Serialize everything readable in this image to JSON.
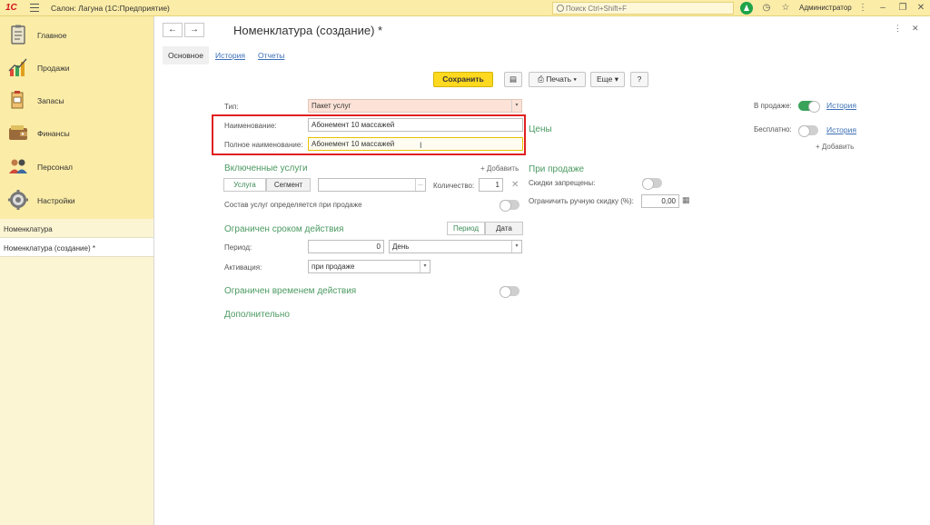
{
  "titlebar": {
    "app_title": "Салон: Лагуна  (1С:Предприятие)",
    "search_placeholder": "Поиск Ctrl+Shift+F",
    "user": "Администратор"
  },
  "sidebar": {
    "sections": [
      {
        "label": "Главное",
        "icon": "clipboard-icon"
      },
      {
        "label": "Продажи",
        "icon": "chart-icon"
      },
      {
        "label": "Запасы",
        "icon": "box-icon"
      },
      {
        "label": "Финансы",
        "icon": "wallet-icon"
      },
      {
        "label": "Персонал",
        "icon": "people-icon"
      },
      {
        "label": "Настройки",
        "icon": "gear-icon"
      }
    ],
    "open_windows": [
      {
        "label": "Номенклатура"
      },
      {
        "label": "Номенклатура (создание) *"
      }
    ]
  },
  "form": {
    "title": "Номенклатура (создание) *",
    "tabs": {
      "main": "Основное",
      "history": "История",
      "reports": "Отчеты"
    },
    "toolbar": {
      "save": "Сохранить",
      "print": "Печать",
      "more": "Еще",
      "help": "?"
    },
    "fields": {
      "type_label": "Тип:",
      "type_value": "Пакет услуг",
      "name_label": "Наименование:",
      "name_value": "Абонемент 10 массажей",
      "fullname_label": "Полное наименование:",
      "fullname_value": "Абонемент 10 массажей"
    },
    "included": {
      "header": "Включенные услуги",
      "add": "+ Добавить",
      "seg_service": "Услуга",
      "seg_segment": "Сегмент",
      "quantity_label": "Количество:",
      "quantity_value": "1",
      "composition_label": "Состав услуг определяется при продаже"
    },
    "term": {
      "header": "Ограничен сроком действия",
      "seg_period": "Период",
      "seg_date": "Дата",
      "period_label": "Период:",
      "period_value": "0",
      "period_unit": "День",
      "activation_label": "Активация:",
      "activation_value": "при продаже"
    },
    "time_limit": {
      "header": "Ограничен временем действия"
    },
    "additional": {
      "header": "Дополнительно"
    },
    "prices": {
      "header": "Цены"
    },
    "sale": {
      "in_sale_label": "В продаже:",
      "history": "История",
      "free_label": "Бесплатно:",
      "free_history": "История",
      "add": "+ Добавить",
      "header": "При продаже",
      "discounts_label": "Скидки запрещены:",
      "manual_discount_label": "Ограничить ручную скидку (%):",
      "manual_discount_value": "0,00"
    }
  }
}
